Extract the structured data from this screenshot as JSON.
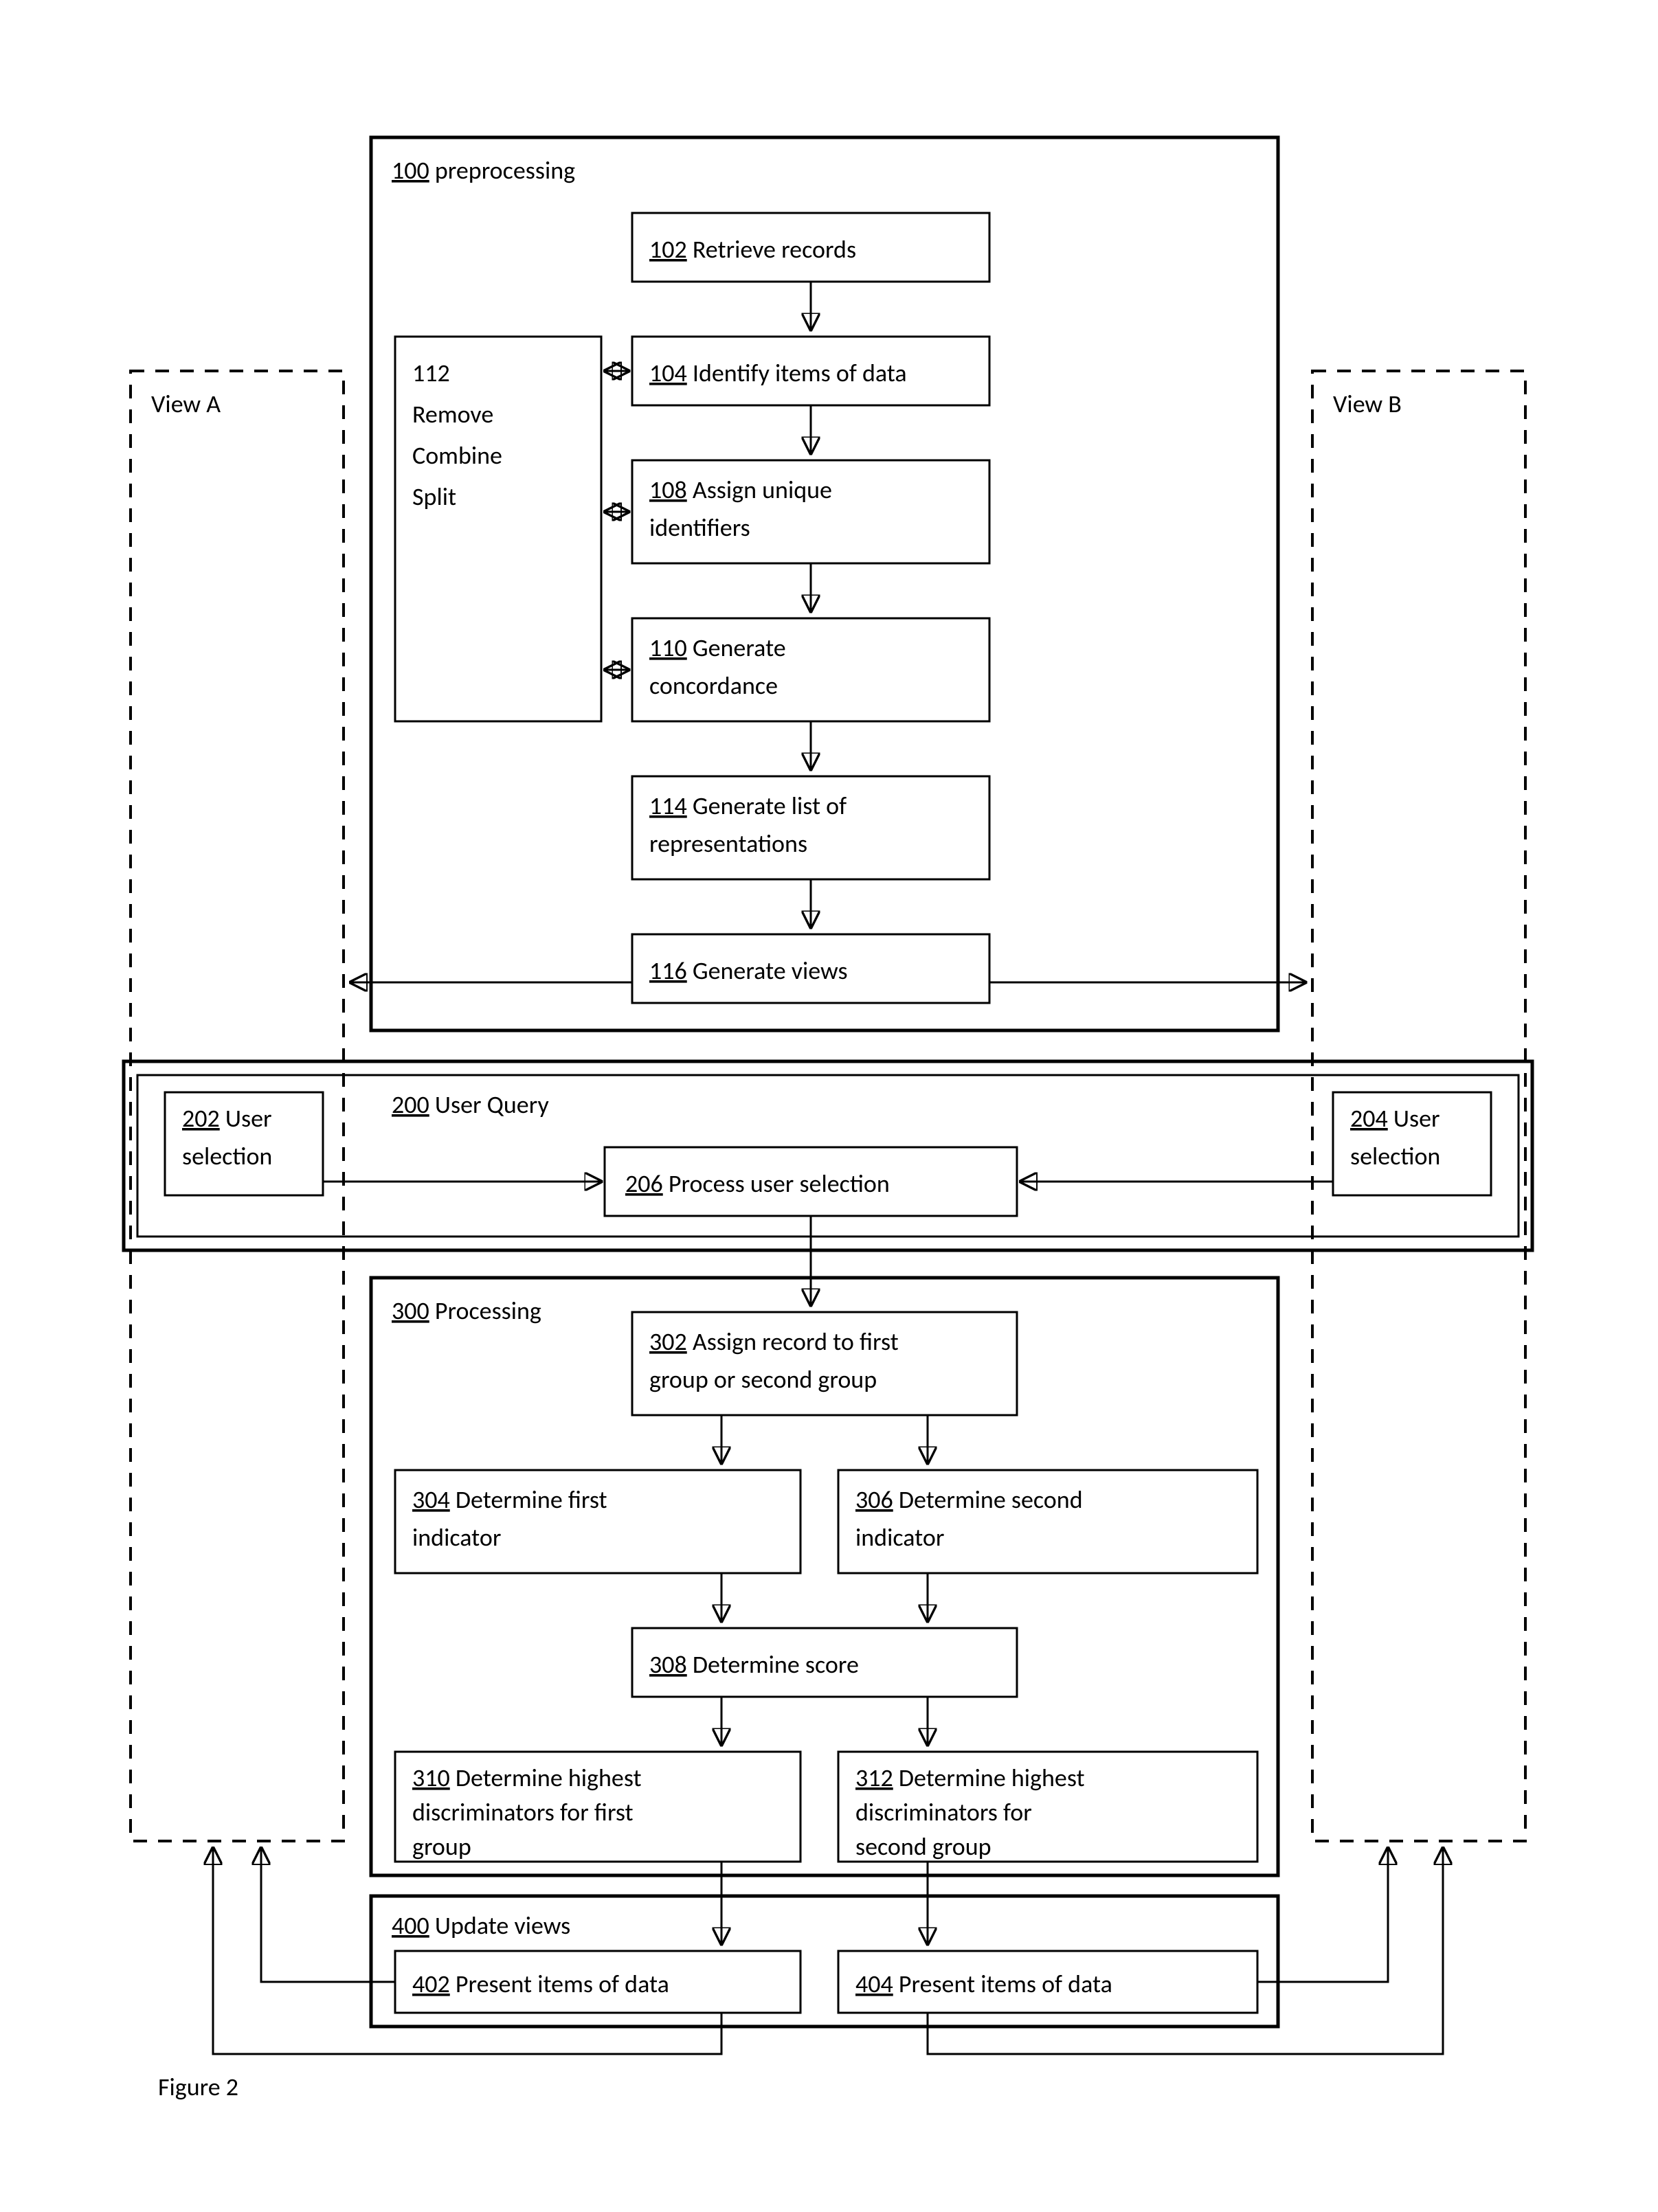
{
  "figure_label": "Figure 2",
  "views": {
    "a": "View A",
    "b": "View B"
  },
  "boxes": {
    "b100": {
      "num": "100",
      "label": "preprocessing"
    },
    "b102": {
      "num": "102",
      "label": "Retrieve records"
    },
    "b104": {
      "num": "104",
      "label": "Identify items of data"
    },
    "b108": {
      "num": "108",
      "label_l1": "Assign unique",
      "label_l2": "identifiers"
    },
    "b110": {
      "num": "110",
      "label_l1": "Generate",
      "label_l2": "concordance"
    },
    "b112": {
      "num": "112",
      "l1": "Remove",
      "l2": "Combine",
      "l3": "Split"
    },
    "b114": {
      "num": "114",
      "label_l1": "Generate list of",
      "label_l2": "representations"
    },
    "b116": {
      "num": "116",
      "label": "Generate views"
    },
    "b200": {
      "num": "200",
      "label": "User Query"
    },
    "b202": {
      "num": "202",
      "label_l1": "User",
      "label_l2": "selection"
    },
    "b204": {
      "num": "204",
      "label_l1": "User",
      "label_l2": "selection"
    },
    "b206": {
      "num": "206",
      "label": "Process user selection"
    },
    "b300": {
      "num": "300",
      "label": "Processing"
    },
    "b302": {
      "num": "302",
      "label_l1": "Assign record to first",
      "label_l2": "group or second group"
    },
    "b304": {
      "num": "304",
      "label_l1": "Determine first",
      "label_l2": "indicator"
    },
    "b306": {
      "num": "306",
      "label_l1": "Determine second",
      "label_l2": "indicator"
    },
    "b308": {
      "num": "308",
      "label": "Determine score"
    },
    "b310": {
      "num": "310",
      "label_l1": "Determine highest",
      "label_l2": "discriminators for first",
      "label_l3": "group"
    },
    "b312": {
      "num": "312",
      "label_l1": "Determine highest",
      "label_l2": "discriminators for",
      "label_l3": "second group"
    },
    "b400": {
      "num": "400",
      "label": "Update views"
    },
    "b402": {
      "num": "402",
      "label": "Present items of data"
    },
    "b404": {
      "num": "404",
      "label": "Present items of data"
    }
  }
}
